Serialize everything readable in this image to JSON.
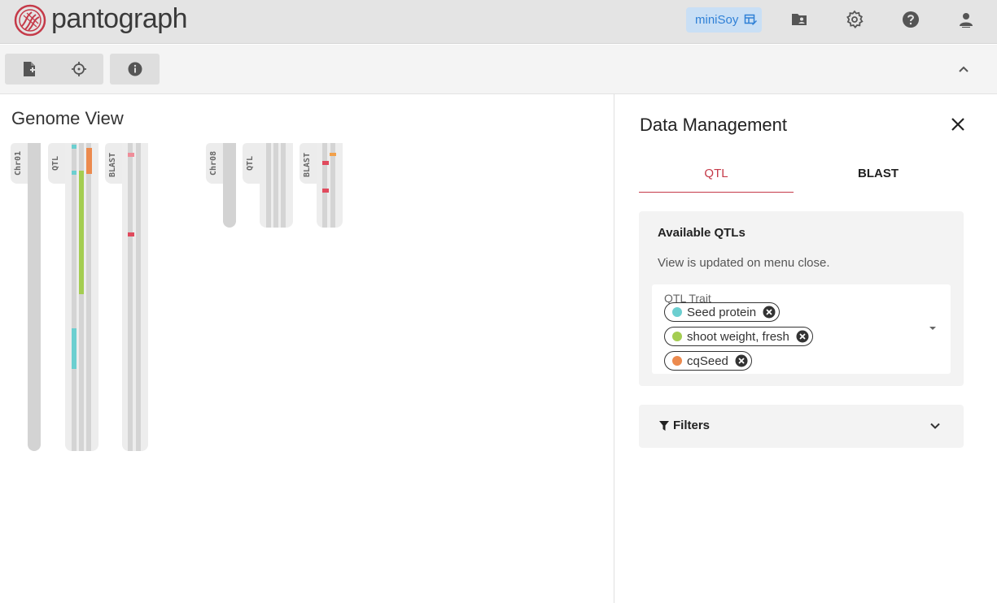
{
  "app": {
    "brand": "pantograph",
    "dataset": "miniSoy"
  },
  "genome_view": {
    "title": "Genome View",
    "chromosomes": [
      {
        "name": "Chr01",
        "tracks": [
          "QTL",
          "BLAST"
        ]
      },
      {
        "name": "Chr08",
        "tracks": [
          "QTL",
          "BLAST"
        ]
      }
    ]
  },
  "panel": {
    "title": "Data Management",
    "tabs": [
      {
        "label": "QTL",
        "active": true
      },
      {
        "label": "BLAST",
        "active": false
      }
    ],
    "available": {
      "title": "Available QTLs",
      "subtitle": "View is updated on menu close.",
      "select_label": "QTL Trait",
      "chips": [
        {
          "label": "Seed protein",
          "color": "#6ccfd0"
        },
        {
          "label": "shoot weight, fresh",
          "color": "#a4cd51"
        },
        {
          "label": "cqSeed",
          "color": "#ec8a4e"
        }
      ]
    },
    "filters_label": "Filters"
  },
  "colors": {
    "brand_red": "#c53a49",
    "seed_protein": "#6ccfd0",
    "shoot_weight": "#a4cd51",
    "cqseed": "#ec8a4e",
    "blast_hit": "#e04a5d",
    "blast_hit_light": "#ef8d99",
    "blast_hit_orange": "#f2a04a"
  }
}
